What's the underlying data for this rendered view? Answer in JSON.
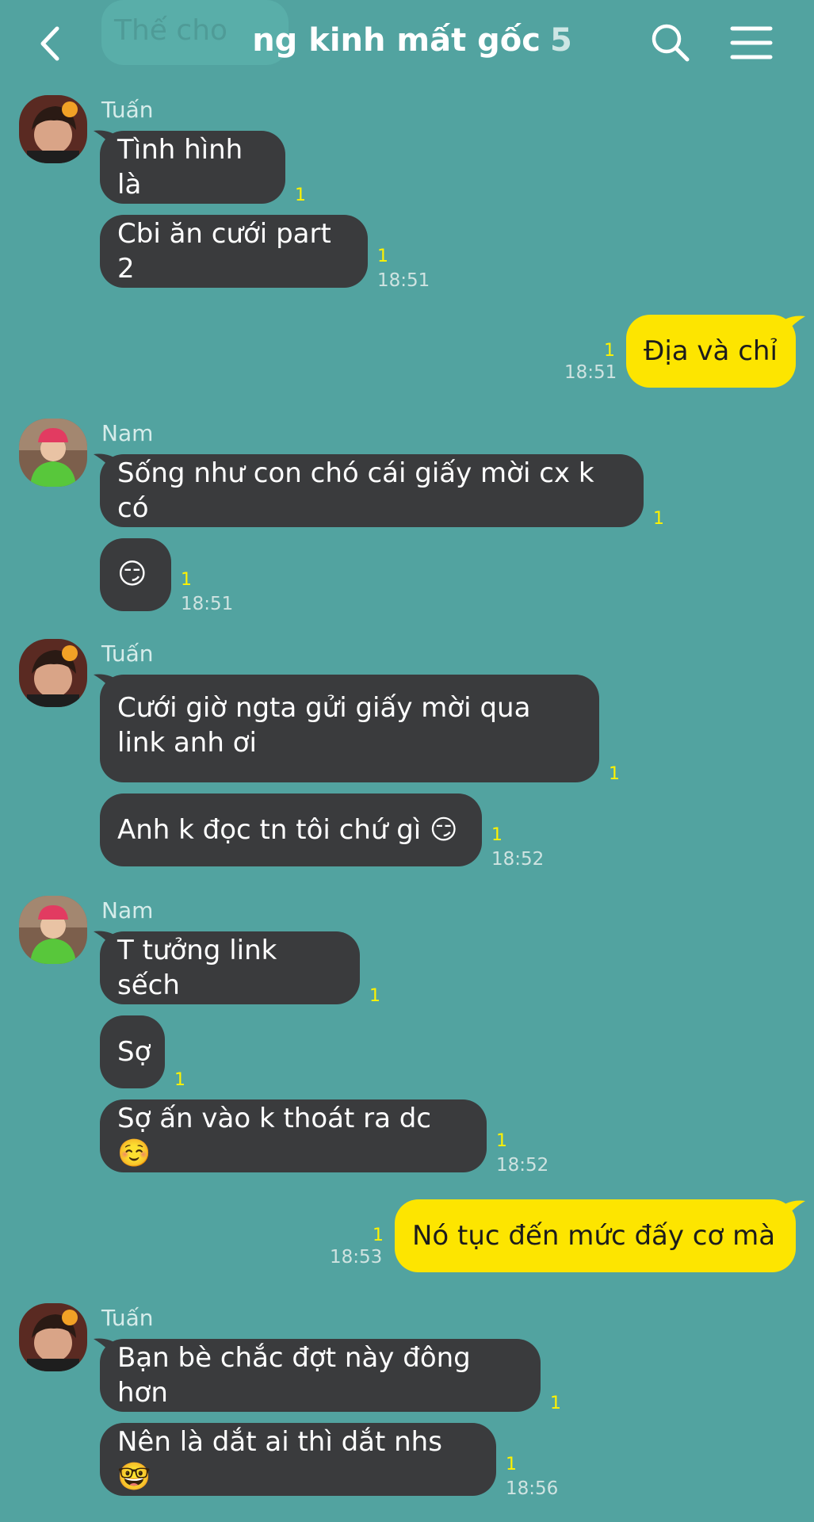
{
  "header": {
    "ghost_preview": "Thế cho",
    "title": "ng kinh mất gốc",
    "member_count": "5"
  },
  "messages": [
    {
      "sender": "Tuấn",
      "bubbles": [
        "Tình hình là",
        "Cbi ăn cưới part 2"
      ],
      "unread": [
        "1",
        "1"
      ],
      "time": "18:51"
    },
    {
      "sender": "",
      "bubbles": [
        "Địa và chỉ"
      ],
      "unread": [
        "1"
      ],
      "time": "18:51",
      "mine": true
    },
    {
      "sender": "Nam",
      "bubbles": [
        "Sống như con chó cái giấy mời cx k có",
        "😏"
      ],
      "unread": [
        "1",
        "1"
      ],
      "time": "18:51"
    },
    {
      "sender": "Tuấn",
      "bubbles": [
        "Cưới giờ ngta gửi giấy mời qua link anh ơi",
        "Anh k đọc tn tôi chứ gì 😏"
      ],
      "unread": [
        "1",
        "1"
      ],
      "time": "18:52"
    },
    {
      "sender": "Nam",
      "bubbles": [
        "T tưởng link sếch",
        "Sợ",
        "Sợ ấn vào k thoát ra dc ☺️"
      ],
      "unread": [
        "1",
        "1",
        "1"
      ],
      "time": "18:52"
    },
    {
      "sender": "",
      "bubbles": [
        "Nó tục đến mức đấy cơ mà"
      ],
      "unread": [
        "1"
      ],
      "time": "18:53",
      "mine": true
    },
    {
      "sender": "Tuấn",
      "bubbles": [
        "Bạn bè chắc đợt này đông hơn",
        "Nên là dắt ai thì dắt nhs 🤓"
      ],
      "unread": [
        "1",
        "1"
      ],
      "time": "18:56"
    }
  ],
  "colors": {
    "background": "#52a3a0",
    "incoming_bubble": "#3a3b3d",
    "outgoing_bubble": "#fde500",
    "unread_marker": "#fff200"
  },
  "icons": [
    "back-arrow-icon",
    "search-icon",
    "menu-icon"
  ]
}
